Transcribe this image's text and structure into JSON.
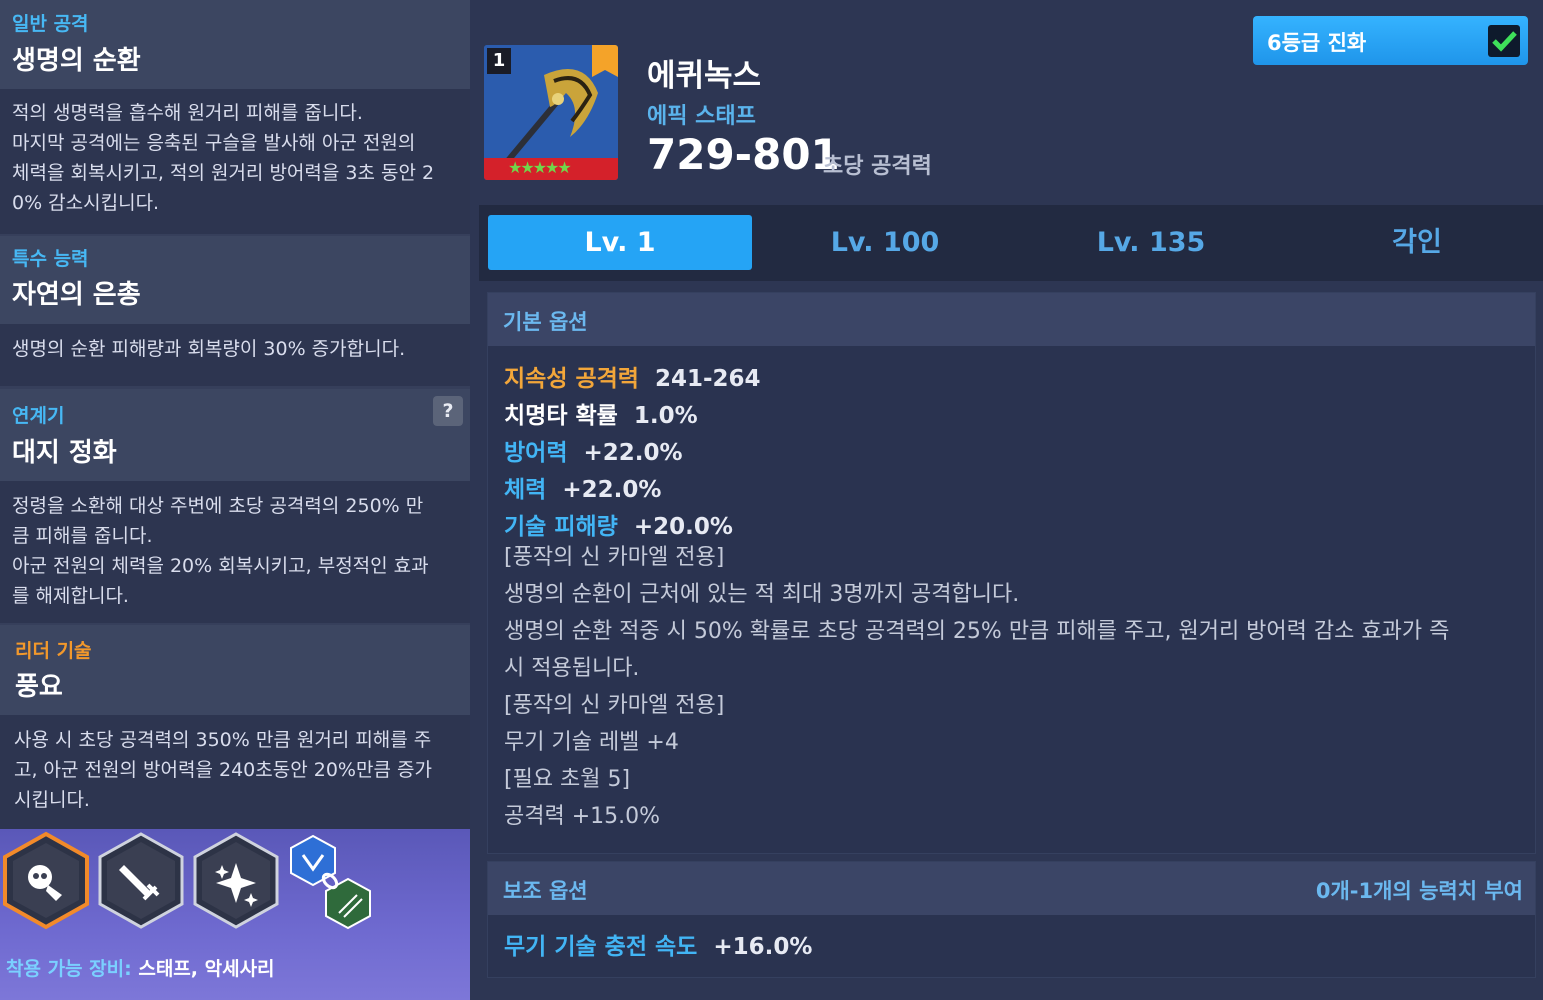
{
  "left": {
    "normal_attack": {
      "type": "일반 공격",
      "name": "생명의 순환",
      "desc": "적의 생명력을 흡수해 원거리 피해를 줍니다.\n마지막 공격에는 응축된 구슬을 발사해 아군 전원의\n체력을 회복시키고, 적의 원거리 방어력을 3초 동안 2\n0% 감소시킵니다."
    },
    "special": {
      "type": "특수 능력",
      "name": "자연의 은총",
      "desc": "생명의 순환 피해량과 회복량이 30% 증가합니다."
    },
    "chain": {
      "type": "연계기",
      "help": "?",
      "name": "대지 정화",
      "desc": "정령을 소환해 대상 주변에 초당 공격력의 250% 만\n큼 피해를 줍니다.\n아군 전원의 체력을 20% 회복시키고, 부정적인 효과\n를 해제합니다."
    },
    "leader": {
      "type": "리더 기술",
      "name": "풍요",
      "desc": "사용 시 초당 공격력의 350% 만큼 원거리 피해를 주\n고, 아군 전원의 방어력을 240초동안 20%만큼 증가\n시킵니다."
    },
    "skill_icons": [
      "skull-shield-icon",
      "sword-icon",
      "sparkle-icon",
      "chain-link-icon"
    ],
    "equip_key": "착용 가능 장비:",
    "equip_value": "스태프, 악세사리"
  },
  "weapon": {
    "rank": "1",
    "name": "에퀴녹스",
    "type": "에픽 스태프",
    "atk_range": "729-801",
    "atk_label": "초당 공격력",
    "stars": "★★★★★",
    "evo_label": "6등급 진화"
  },
  "tabs": [
    "Lv. 1",
    "Lv. 100",
    "Lv. 135",
    "각인"
  ],
  "basic": {
    "title": "기본 옵션",
    "options": [
      {
        "key": "지속성 공격력",
        "value": "241-264"
      },
      {
        "key": "치명타 확률",
        "value": "1.0%"
      },
      {
        "key": "방어력",
        "value": "+22.0%"
      },
      {
        "key": "체력",
        "value": "+22.0%"
      },
      {
        "key": "기술 피해량",
        "value": "+20.0%"
      }
    ],
    "notes": "[풍작의 신 카마엘 전용]\n생명의 순환이 근처에 있는 적 최대 3명까지 공격합니다.\n생명의 순환 적중 시 50% 확률로 초당 공격력의 25% 만큼 피해를 주고, 원거리 방어력 감소 효과가 즉\n시 적용됩니다.\n[풍작의 신 카마엘 전용]\n무기 기술 레벨 +4\n[필요 초월 5]\n공격력 +15.0%"
  },
  "sub": {
    "title": "보조 옵션",
    "range": "0개-1개의 능력치 부여",
    "option_key": "무기 기술 충전 속도",
    "option_value": "+16.0%"
  }
}
